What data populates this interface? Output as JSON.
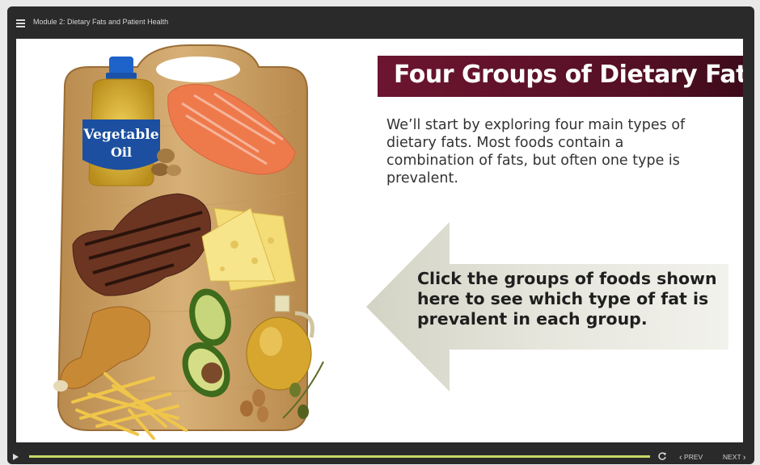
{
  "header": {
    "module_title": "Module 2: Dietary Fats and Patient Health",
    "menu_icon": "hamburger-menu-icon"
  },
  "slide": {
    "title": "Four Groups of Dietary Fats",
    "intro_text": "We’ll start by exploring four main types of dietary fats. Most foods contain a combination of fats, but often one type is prevalent.",
    "instruction_text": "Click the groups of foods shown here to see which type of fat is prevalent in each group.",
    "bottle_label_line1": "Vegetable",
    "bottle_label_line2": "Oil",
    "colors": {
      "title_banner": "#6d1530",
      "arrow": "#e4e4da",
      "progress": "#c9d96a"
    }
  },
  "controls": {
    "play_icon": "play-icon",
    "progress_fraction": 1.0,
    "replay_icon": "replay-icon",
    "prev_label": "PREV",
    "next_label": "NEXT"
  }
}
